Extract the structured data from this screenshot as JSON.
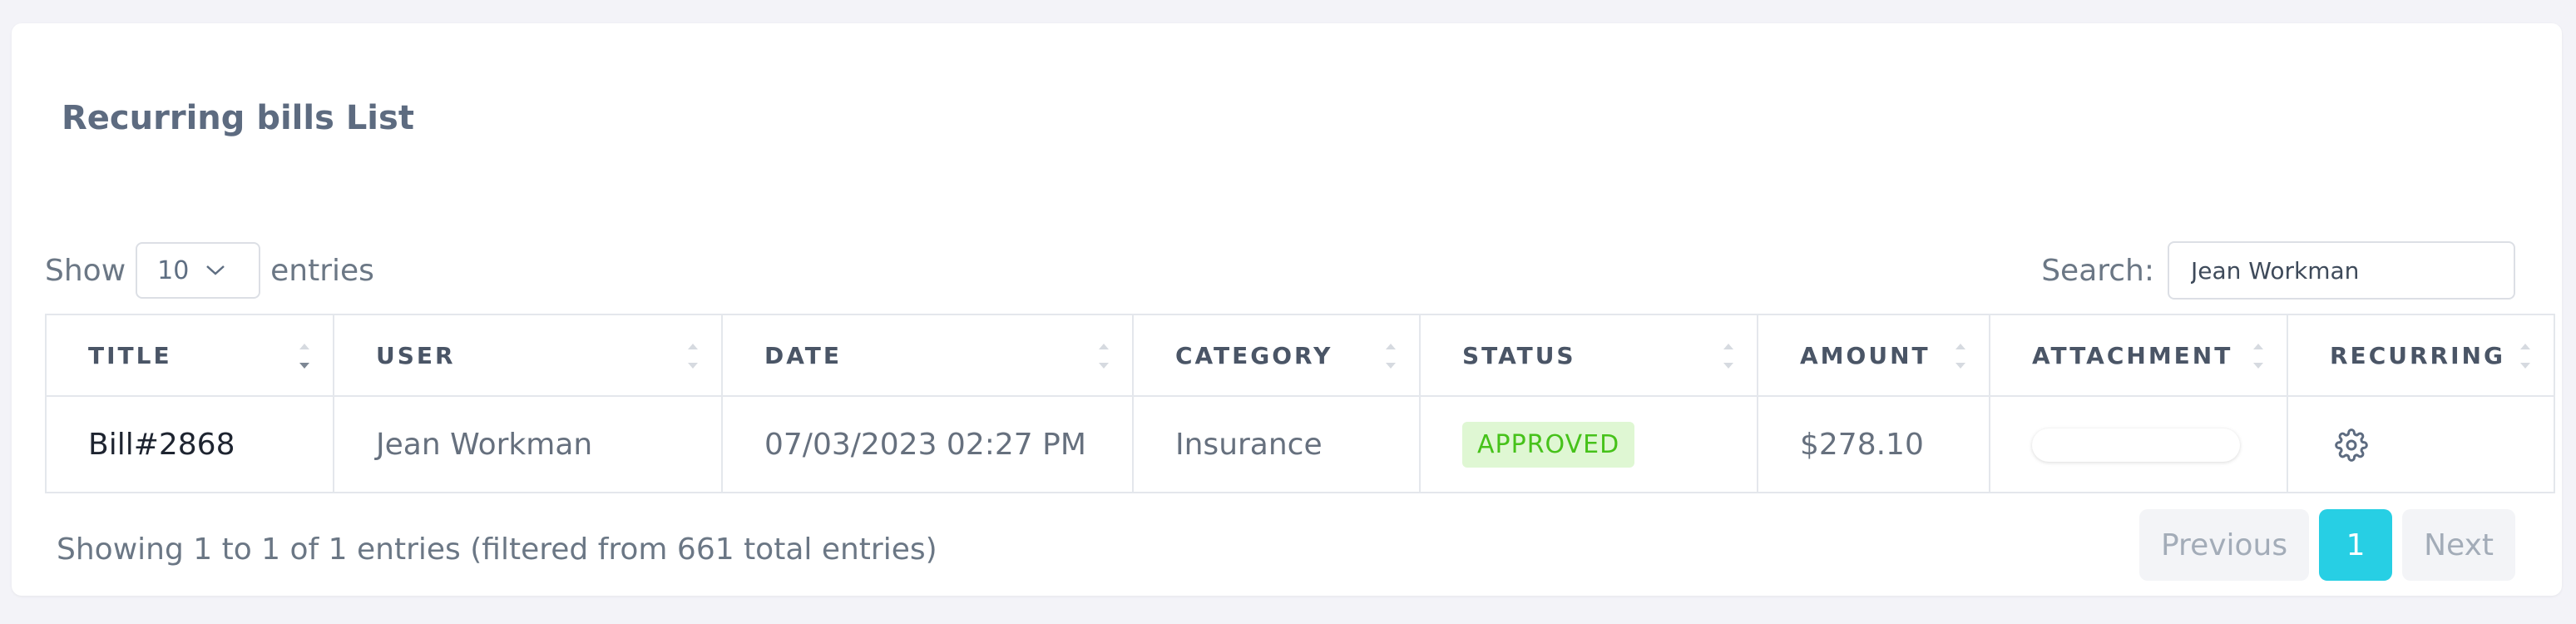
{
  "card": {
    "title": "Recurring bills List"
  },
  "controls": {
    "show_label": "Show",
    "entries_label": "entries",
    "page_length": "10",
    "search_label": "Search:",
    "search_value": "Jean Workman"
  },
  "table": {
    "columns": [
      "TITLE",
      "USER",
      "DATE",
      "CATEGORY",
      "STATUS",
      "AMOUNT",
      "ATTACHMENT",
      "RECURRING"
    ],
    "rows": [
      {
        "title": "Bill#2868",
        "user": "Jean Workman",
        "date": "07/03/2023 02:27 PM",
        "category": "Insurance",
        "status": "APPROVED",
        "amount": "$278.10",
        "recurring_icon": "gear-icon"
      }
    ]
  },
  "footer": {
    "info": "Showing 1 to 1 of 1 entries (filtered from 661 total entries)",
    "previous": "Previous",
    "current_page": "1",
    "next": "Next"
  },
  "colors": {
    "accent": "#27cfe4",
    "approved_bg": "#dff7d3",
    "approved_text": "#46c21a"
  }
}
